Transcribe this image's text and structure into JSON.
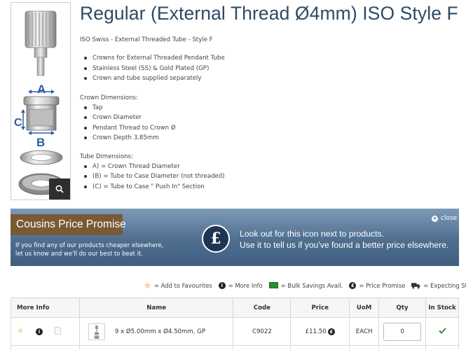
{
  "product": {
    "title": "Regular (External Thread Ø4mm) ISO Style F",
    "subtitle": "ISO Swiss - External Threaded Tube - Style F",
    "features": [
      "Crowns for External Threaded Pendant Tube",
      "Stainless Steel (SS) & Gold Plated (GP)",
      "Crown and tube supplied separately"
    ],
    "crown_heading": "Crown Dimensions:",
    "crown_dims": [
      "Tap",
      "Crown Diameter",
      "Pendant Thread to Crown Ø",
      "Crown Depth 3.85mm"
    ],
    "tube_heading": "Tube Dimensions:",
    "tube_dims": [
      "A) = Crown Thread Diameter",
      "(B) = Tube to Case Diameter (not threaded)",
      "(C) = Tube to Case \" Push In\" Section"
    ],
    "image_labels": {
      "a": "A",
      "b": "B",
      "c": "C"
    }
  },
  "banner": {
    "title": "Cousins Price Promise",
    "sub_line1": "If you find any of our products cheaper elsewhere,",
    "sub_line2": "let us know and we'll do our best to beat it.",
    "pound_symbol": "£",
    "msg_line1": "Look out for this icon next to products.",
    "msg_line2": "Use it to tell us if you've found a better price elsewhere.",
    "close_label": "close"
  },
  "legend": {
    "favourites": "= Add to Favourites",
    "more_info": "= More Info",
    "bulk": "= Bulk Savings Avail.",
    "price_promise": "= Price Promise",
    "stock": "= Expecting Stock"
  },
  "table": {
    "headers": [
      "More Info",
      "Name",
      "Code",
      "Price",
      "UoM",
      "Qty",
      "In Stock"
    ],
    "rows": [
      {
        "name": "9 x Ø5.00mm x Ø4.50mm, GP",
        "code": "C9022",
        "price": "£11.50",
        "uom": "EACH",
        "qty": "0"
      }
    ]
  },
  "colors": {
    "title": "#2e4a66",
    "banner_brown": "#7a5a34",
    "banner_blue": "#4f6e90",
    "in_stock": "#3e8e41"
  },
  "icons": {
    "zoom": "search-icon",
    "favourite": "star-icon",
    "info": "info-icon",
    "bulk": "bulk-savings-icon",
    "promise": "pound-icon",
    "stock": "truck-icon",
    "pdf": "document-icon",
    "in_stock": "check-icon",
    "close": "close-icon"
  }
}
